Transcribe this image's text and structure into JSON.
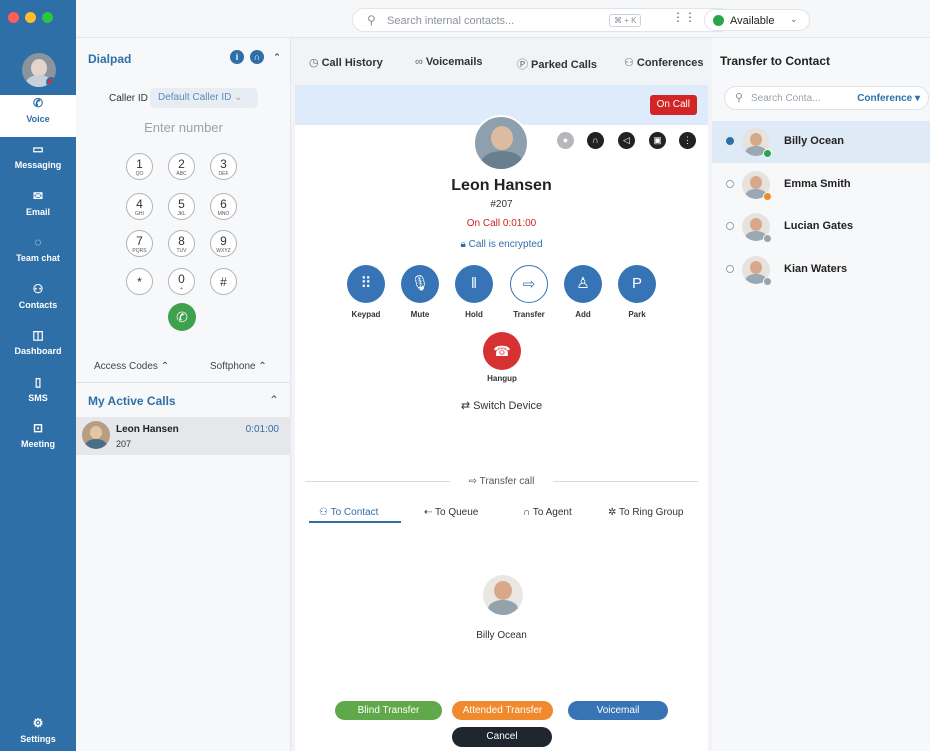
{
  "colors": {
    "brand": "#2f6fa8",
    "danger": "#d32525",
    "green": "#3fa04e",
    "orange": "#f08a2c"
  },
  "topbar": {
    "search_placeholder": "Search internal contacts...",
    "shortcut": "⌘ + K",
    "status": "Available"
  },
  "rail": {
    "items": [
      {
        "label": "Voice",
        "icon": "phone-icon"
      },
      {
        "label": "Messaging",
        "icon": "chat-icon"
      },
      {
        "label": "Email",
        "icon": "mail-icon"
      },
      {
        "label": "Team chat",
        "icon": "team-chat-icon"
      },
      {
        "label": "Contacts",
        "icon": "contacts-icon"
      },
      {
        "label": "Dashboard",
        "icon": "dashboard-icon"
      },
      {
        "label": "SMS",
        "icon": "sms-icon"
      },
      {
        "label": "Meeting",
        "icon": "meeting-icon"
      }
    ],
    "settings": "Settings"
  },
  "dialpad": {
    "title": "Dialpad",
    "caller_id_label": "Caller ID",
    "caller_id_value": "Default Caller ID",
    "placeholder": "Enter number",
    "keys": [
      {
        "n": "1",
        "l": "QO"
      },
      {
        "n": "2",
        "l": "ABC"
      },
      {
        "n": "3",
        "l": "DEF"
      },
      {
        "n": "4",
        "l": "GHI"
      },
      {
        "n": "5",
        "l": "JKL"
      },
      {
        "n": "6",
        "l": "MNO"
      },
      {
        "n": "7",
        "l": "PQRS"
      },
      {
        "n": "8",
        "l": "TUV"
      },
      {
        "n": "9",
        "l": "WXYZ"
      },
      {
        "n": "*",
        "l": ""
      },
      {
        "n": "0",
        "l": "+"
      },
      {
        "n": "#",
        "l": ""
      }
    ],
    "access_codes": "Access Codes ⌃",
    "softphone": "Softphone ⌃"
  },
  "active_calls": {
    "title": "My Active Calls",
    "items": [
      {
        "name": "Leon Hansen",
        "ext": "207",
        "time": "0:01:00"
      }
    ]
  },
  "tabs": [
    {
      "label": "Call History",
      "icon": "clock-icon"
    },
    {
      "label": "Voicemails",
      "icon": "voicemail-icon"
    },
    {
      "label": "Parked Calls",
      "icon": "park-icon"
    },
    {
      "label": "Conferences",
      "icon": "conference-icon"
    }
  ],
  "call": {
    "badge": "On Call",
    "name": "Leon Hansen",
    "ext": "#207",
    "status": "On Call 0:01:00",
    "encrypted": "Call is encrypted",
    "actions": [
      {
        "label": "Keypad",
        "icon": "keypad-icon"
      },
      {
        "label": "Mute",
        "icon": "microphone-icon"
      },
      {
        "label": "Hold",
        "icon": "pause-icon"
      },
      {
        "label": "Transfer",
        "icon": "transfer-icon"
      },
      {
        "label": "Add",
        "icon": "add-user-icon"
      },
      {
        "label": "Park",
        "icon": "park-icon"
      }
    ],
    "hangup": "Hangup",
    "switch_device": "Switch Device"
  },
  "transfer": {
    "title": "Transfer call",
    "tabs": [
      "To Contact",
      "To Queue",
      "To Agent",
      "To Ring Group"
    ],
    "selected_name": "Billy Ocean",
    "buttons": {
      "blind": "Blind Transfer",
      "attended": "Attended Transfer",
      "voicemail": "Voicemail",
      "cancel": "Cancel"
    }
  },
  "contacts_panel": {
    "title": "Transfer to Contact",
    "search_placeholder": "Search Conta...",
    "conference": "Conference ▾",
    "items": [
      {
        "name": "Billy Ocean",
        "selected": true,
        "presence": "#2ca44a"
      },
      {
        "name": "Emma Smith",
        "selected": false,
        "presence": "#f08a2c"
      },
      {
        "name": "Lucian Gates",
        "selected": false,
        "presence": "#9aa2aa"
      },
      {
        "name": "Kian Waters",
        "selected": false,
        "presence": "#9aa2aa"
      }
    ]
  }
}
